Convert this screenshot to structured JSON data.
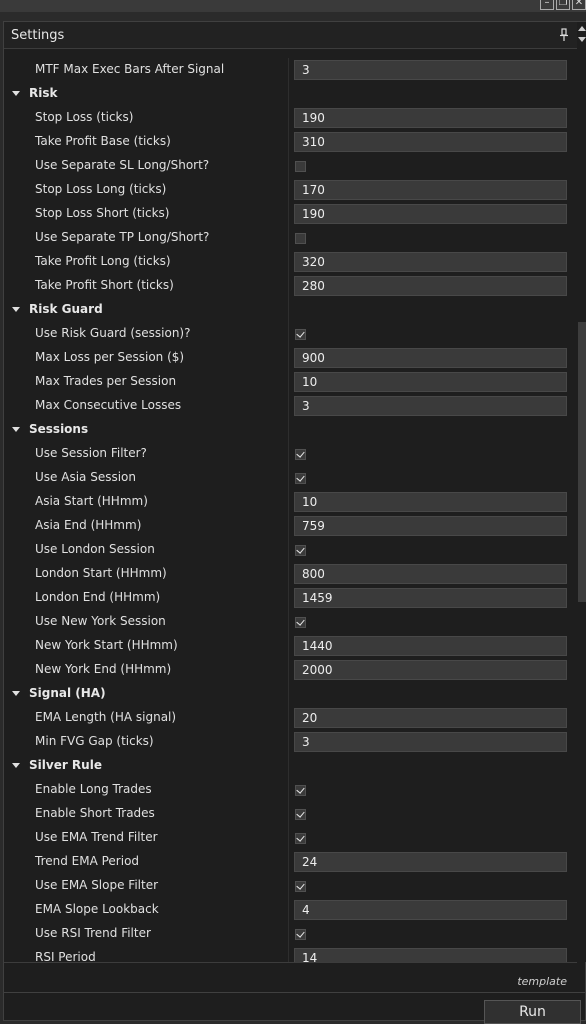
{
  "window": {
    "minimize_label": "–",
    "restore_label": "❐",
    "close_label": "✕"
  },
  "panel": {
    "title": "Settings",
    "footer_label": "template",
    "run_label": "Run"
  },
  "rows": [
    {
      "type": "prop",
      "label": "MTF Max Exec Bars After Signal",
      "value": "3"
    },
    {
      "type": "cat",
      "label": "Risk"
    },
    {
      "type": "prop",
      "label": "Stop Loss (ticks)",
      "value": "190"
    },
    {
      "type": "prop",
      "label": "Take Profit Base (ticks)",
      "value": "310"
    },
    {
      "type": "check",
      "label": "Use Separate SL Long/Short?",
      "checked": false
    },
    {
      "type": "prop",
      "label": "Stop Loss Long (ticks)",
      "value": "170"
    },
    {
      "type": "prop",
      "label": "Stop Loss Short (ticks)",
      "value": "190"
    },
    {
      "type": "check",
      "label": "Use Separate TP Long/Short?",
      "checked": false
    },
    {
      "type": "prop",
      "label": "Take Profit Long (ticks)",
      "value": "320"
    },
    {
      "type": "prop",
      "label": "Take Profit Short (ticks)",
      "value": "280"
    },
    {
      "type": "cat",
      "label": "Risk Guard"
    },
    {
      "type": "check",
      "label": "Use Risk Guard (session)?",
      "checked": true
    },
    {
      "type": "prop",
      "label": "Max Loss per Session ($)",
      "value": "900"
    },
    {
      "type": "prop",
      "label": "Max Trades per Session",
      "value": "10"
    },
    {
      "type": "prop",
      "label": "Max Consecutive Losses",
      "value": "3"
    },
    {
      "type": "cat",
      "label": "Sessions"
    },
    {
      "type": "check",
      "label": "Use Session Filter?",
      "checked": true
    },
    {
      "type": "check",
      "label": "Use Asia Session",
      "checked": true
    },
    {
      "type": "prop",
      "label": "Asia Start (HHmm)",
      "value": "10"
    },
    {
      "type": "prop",
      "label": "Asia End (HHmm)",
      "value": "759"
    },
    {
      "type": "check",
      "label": "Use London Session",
      "checked": true
    },
    {
      "type": "prop",
      "label": "London Start (HHmm)",
      "value": "800"
    },
    {
      "type": "prop",
      "label": "London End (HHmm)",
      "value": "1459"
    },
    {
      "type": "check",
      "label": "Use New York Session",
      "checked": true
    },
    {
      "type": "prop",
      "label": "New York Start (HHmm)",
      "value": "1440"
    },
    {
      "type": "prop",
      "label": "New York End (HHmm)",
      "value": "2000"
    },
    {
      "type": "cat",
      "label": "Signal (HA)"
    },
    {
      "type": "prop",
      "label": "EMA Length (HA signal)",
      "value": "20"
    },
    {
      "type": "prop",
      "label": "Min FVG Gap (ticks)",
      "value": "3"
    },
    {
      "type": "cat",
      "label": "Silver Rule"
    },
    {
      "type": "check",
      "label": "Enable Long Trades",
      "checked": true
    },
    {
      "type": "check",
      "label": "Enable Short Trades",
      "checked": true
    },
    {
      "type": "check",
      "label": "Use EMA Trend Filter",
      "checked": true
    },
    {
      "type": "prop",
      "label": "Trend EMA Period",
      "value": "24"
    },
    {
      "type": "check",
      "label": "Use EMA Slope Filter",
      "checked": true
    },
    {
      "type": "prop",
      "label": "EMA Slope Lookback",
      "value": "4"
    },
    {
      "type": "check",
      "label": "Use RSI Trend Filter",
      "checked": true
    },
    {
      "type": "prop",
      "label": "RSI Period",
      "value": "14"
    }
  ]
}
